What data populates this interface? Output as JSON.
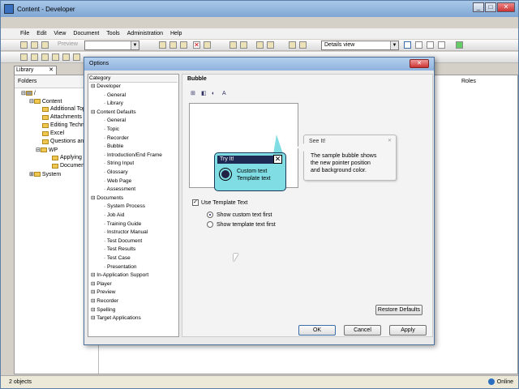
{
  "app": {
    "title": "Content - Developer",
    "menu": [
      "File",
      "Edit",
      "View",
      "Document",
      "Tools",
      "Administration",
      "Help"
    ],
    "toolbar": {
      "preview": "Preview",
      "view_combo": "Details view"
    },
    "library_tab": "Library",
    "folders_header": "Folders",
    "roles_header": "Roles",
    "tree": [
      {
        "label": "/",
        "level": 0
      },
      {
        "label": "Content",
        "level": 1
      },
      {
        "label": "Additional Top",
        "level": 2
      },
      {
        "label": "Attachments",
        "level": 2
      },
      {
        "label": "Editing Techni",
        "level": 2
      },
      {
        "label": "Excel",
        "level": 2
      },
      {
        "label": "Questions and",
        "level": 2
      },
      {
        "label": "WP",
        "level": 2
      },
      {
        "label": "Applying F",
        "level": 3
      },
      {
        "label": "Document",
        "level": 3
      },
      {
        "label": "System",
        "level": 1
      }
    ],
    "status": {
      "left": "2 objects",
      "right": "Online"
    }
  },
  "dialog": {
    "title": "Options",
    "category_header": "Category",
    "categories": [
      {
        "label": "Developer",
        "level": 0
      },
      {
        "label": "General",
        "level": 1
      },
      {
        "label": "Library",
        "level": 1
      },
      {
        "label": "Content Defaults",
        "level": 0
      },
      {
        "label": "General",
        "level": 1
      },
      {
        "label": "Topic",
        "level": 1
      },
      {
        "label": "Recorder",
        "level": 1
      },
      {
        "label": "Bubble",
        "level": 1
      },
      {
        "label": "Introduction/End Frame",
        "level": 1
      },
      {
        "label": "String Input",
        "level": 1
      },
      {
        "label": "Glossary",
        "level": 1
      },
      {
        "label": "Web Page",
        "level": 1
      },
      {
        "label": "Assessment",
        "level": 1
      },
      {
        "label": "Documents",
        "level": 0
      },
      {
        "label": "System Process",
        "level": 1
      },
      {
        "label": "Job Aid",
        "level": 1
      },
      {
        "label": "Training Guide",
        "level": 1
      },
      {
        "label": "Instructor Manual",
        "level": 1
      },
      {
        "label": "Test Document",
        "level": 1
      },
      {
        "label": "Test Results",
        "level": 1
      },
      {
        "label": "Test Case",
        "level": 1
      },
      {
        "label": "Presentation",
        "level": 1
      },
      {
        "label": "In-Application Support",
        "level": 0
      },
      {
        "label": "Player",
        "level": 0
      },
      {
        "label": "Preview",
        "level": 0
      },
      {
        "label": "Recorder",
        "level": 0
      },
      {
        "label": "Spelling",
        "level": 0
      },
      {
        "label": "Target Applications",
        "level": 0
      }
    ],
    "panel_title": "Bubble",
    "bubble": {
      "title": "Try It!",
      "line1": "Custom text",
      "line2": "Template text"
    },
    "see_it": {
      "title": "See It!",
      "lines": [
        "The sample bubble shows",
        "the new pointer position",
        "and background color."
      ]
    },
    "use_template": "Use Template Text",
    "radio1": "Show custom text first",
    "radio2": "Show template text first",
    "restore": "Restore Defaults",
    "ok": "OK",
    "cancel": "Cancel",
    "apply": "Apply"
  }
}
